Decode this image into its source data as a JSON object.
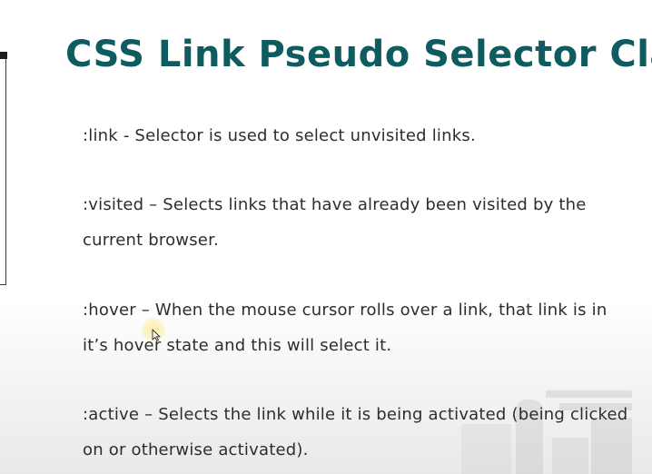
{
  "slide": {
    "title": "CSS Link Pseudo Selector Class",
    "items": [
      ":link - Selector is used to select unvisited links.",
      ":visited – Selects links that have already been visited by the current browser.",
      ":hover – When the mouse cursor rolls over a link, that link is in it’s hover state and this will select it.",
      ":active – Selects the link while it is being activated (being clicked on or otherwise activated)."
    ]
  },
  "colors": {
    "title": "#0e5b60",
    "body_text": "#2d2d2d",
    "background": "#ffffff"
  },
  "icons": {
    "cursor": "mouse-pointer-icon"
  }
}
